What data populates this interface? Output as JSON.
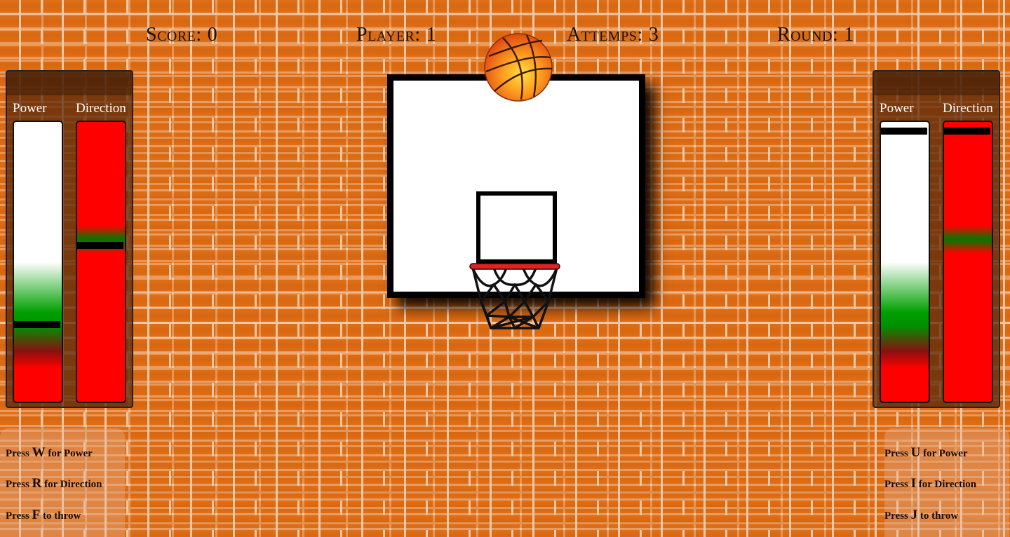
{
  "hud": {
    "score_label": "Score:",
    "score_value": "0",
    "player_label": "Player:",
    "player_value": "1",
    "attempts_label": "Attemps:",
    "attempts_value": "3",
    "round_label": "Round:",
    "round_value": "1"
  },
  "left_panel": {
    "power_label": "Power",
    "direction_label": "Direction",
    "power_level": 0.27,
    "direction_level": 0.56
  },
  "right_panel": {
    "power_label": "Power",
    "direction_label": "Direction",
    "power_level": 0.98,
    "direction_level": 0.98
  },
  "left_help": [
    {
      "pre": "Press",
      "key": "W",
      "post": "for Power"
    },
    {
      "pre": "Press",
      "key": "R",
      "post": "for Direction"
    },
    {
      "pre": "Press",
      "key": "F",
      "post": "to throw"
    }
  ],
  "right_help": [
    {
      "pre": "Press",
      "key": "U",
      "post": "for Power"
    },
    {
      "pre": "Press",
      "key": "I",
      "post": "for Direction"
    },
    {
      "pre": "Press",
      "key": "J",
      "post": "to throw"
    }
  ],
  "colors": {
    "brick": "#d9660f",
    "mortar": "#f0c8a8",
    "meter_good": "#009000",
    "meter_bad": "#ff0000",
    "rim": "#e52020"
  },
  "icons": [
    "basketball-icon",
    "hoop-net-icon"
  ]
}
